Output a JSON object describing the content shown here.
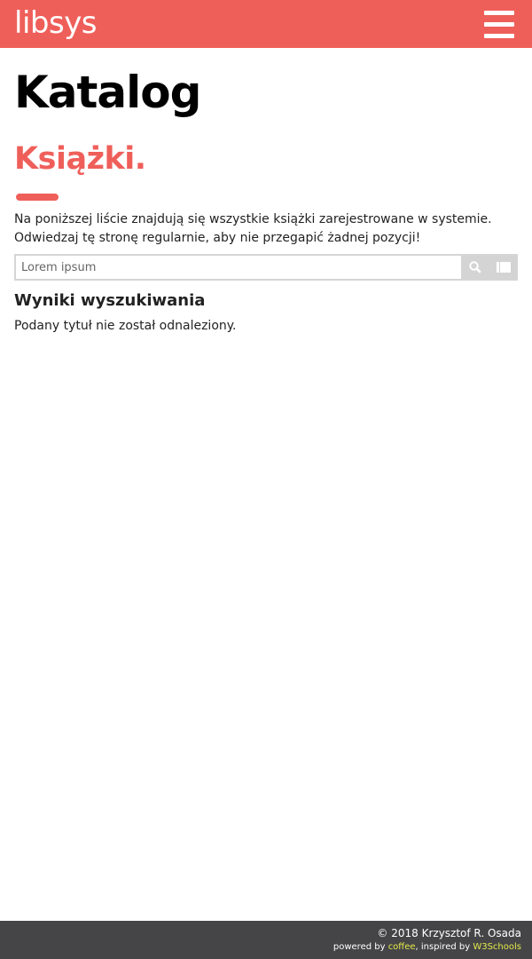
{
  "header": {
    "brand": "libsys",
    "menu_icon": "hamburger-menu-icon",
    "background": "#ef5f5a"
  },
  "page": {
    "title": "Katalog",
    "section_title": "Książki.",
    "intro": "Na poniższej liście znajdują się wszystkie książki zarejestrowane w systemie. Odwiedzaj tę stronę regularnie, aby nie przegapić żadnej pozycji!",
    "accent_color": "#ef5f5a"
  },
  "search": {
    "placeholder": "Lorem ipsum",
    "search_icon": "search-icon",
    "list_icon": "list-view-icon"
  },
  "results": {
    "title": "Wyniki wyszukiwania",
    "message": "Podany tytuł nie został odnaleziony."
  },
  "footer": {
    "copyright": "© 2018 Krzysztof R. Osada",
    "powered_prefix": "powered by ",
    "powered_link": "coffee",
    "inspired_prefix": ", inspired by ",
    "inspired_link": "W3Schools",
    "link_color": "#e2e94a"
  }
}
